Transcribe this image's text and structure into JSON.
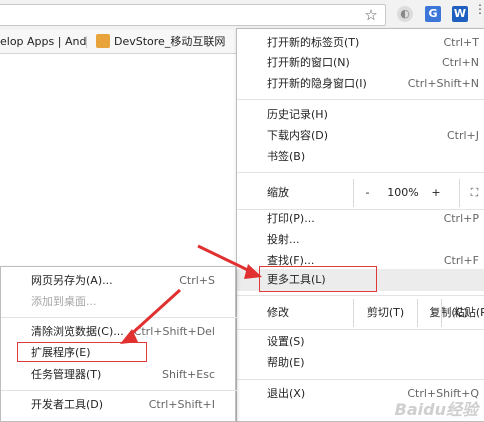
{
  "toolbar": {
    "star_icon": "star-icon",
    "ext_icons": [
      "opera-icon",
      "translate-icon",
      "w-icon"
    ],
    "w_label": "W",
    "menu_icon": "menu-icon"
  },
  "bookmarks": {
    "item1": "elop Apps | And",
    "item2": "DevStore_移动互联网"
  },
  "chrome_menu": {
    "new_tab": {
      "label": "打开新的标签页(T)",
      "shortcut": "Ctrl+T"
    },
    "new_window": {
      "label": "打开新的窗口(N)",
      "shortcut": "Ctrl+N"
    },
    "incognito": {
      "label": "打开新的隐身窗口(I)",
      "shortcut": "Ctrl+Shift+N"
    },
    "history": {
      "label": "历史记录(H)"
    },
    "downloads": {
      "label": "下载内容(D)",
      "shortcut": "Ctrl+J"
    },
    "bookmarks": {
      "label": "书签(B)"
    },
    "zoom": {
      "label": "缩放",
      "minus": "-",
      "value": "100%",
      "plus": "+"
    },
    "print": {
      "label": "打印(P)...",
      "shortcut": "Ctrl+P"
    },
    "cast": {
      "label": "投射..."
    },
    "find": {
      "label": "查找(F)...",
      "shortcut": "Ctrl+F"
    },
    "more_tools": {
      "label": "更多工具(L)"
    },
    "edit": {
      "label": "修改",
      "cut": "剪切(T)",
      "copy": "复制(C)",
      "paste": "粘贴(P)"
    },
    "settings": {
      "label": "设置(S)"
    },
    "help": {
      "label": "帮助(E)"
    },
    "exit": {
      "label": "退出(X)",
      "shortcut": "Ctrl+Shift+Q"
    }
  },
  "submenu": {
    "save_page": {
      "label": "网页另存为(A)...",
      "shortcut": "Ctrl+S"
    },
    "add_desktop": {
      "label": "添加到桌面..."
    },
    "clear_data": {
      "label": "清除浏览数据(C)...",
      "shortcut": "Ctrl+Shift+Del"
    },
    "extensions": {
      "label": "扩展程序(E)"
    },
    "task_manager": {
      "label": "任务管理器(T)",
      "shortcut": "Shift+Esc"
    },
    "dev_tools": {
      "label": "开发者工具(D)",
      "shortcut": "Ctrl+Shift+I"
    }
  },
  "colors": {
    "highlight_box": "#e03a3a",
    "arrow": "#e0302f"
  },
  "watermark": "Baidu经验"
}
